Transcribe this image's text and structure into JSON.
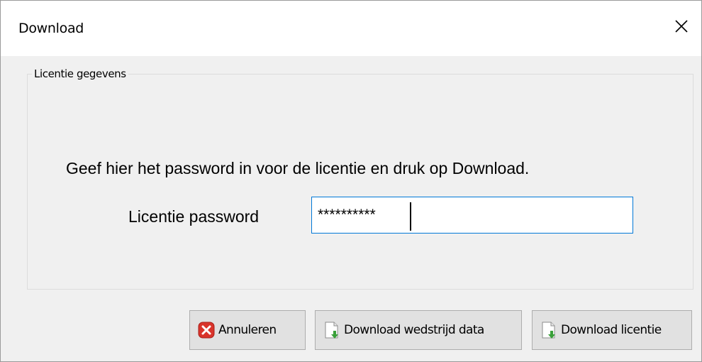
{
  "window": {
    "title": "Download",
    "close_icon": "close-icon"
  },
  "groupbox": {
    "legend": "Licentie gegevens"
  },
  "instruction": "Geef hier het password in voor de licentie en druk op Download.",
  "password": {
    "label": "Licentie password",
    "value": "**********"
  },
  "buttons": {
    "cancel": {
      "label": "Annuleren",
      "icon": "cancel-icon"
    },
    "download_data": {
      "label": "Download wedstrijd data",
      "icon": "download-file-icon"
    },
    "download_license": {
      "label": "Download licentie",
      "icon": "download-file-icon"
    }
  },
  "colors": {
    "dialog_bg": "#f0f0f0",
    "titlebar_bg": "#ffffff",
    "focus_border": "#0078d7",
    "button_bg": "#e1e1e1",
    "cancel_icon_red": "#d9342b",
    "download_arrow_green": "#3aa03a"
  }
}
